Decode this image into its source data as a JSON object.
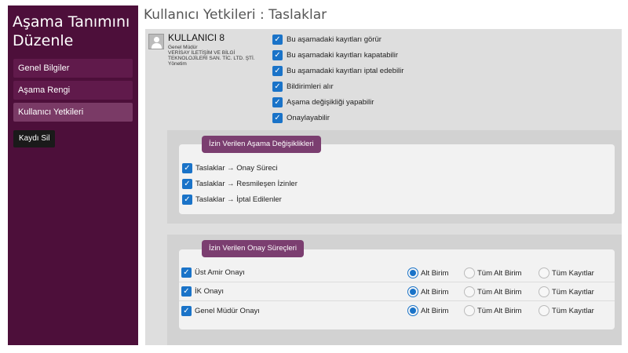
{
  "sidebar": {
    "title_line1": "Aşama Tanımını",
    "title_line2": "Düzenle",
    "items": [
      {
        "label": "Genel Bilgiler"
      },
      {
        "label": "Aşama Rengi"
      },
      {
        "label": "Kullanıcı Yetkileri"
      }
    ],
    "delete_label": "Kaydı Sil"
  },
  "main": {
    "title": "Kullanıcı Yetkileri : Taslaklar"
  },
  "user": {
    "name": "KULLANICI 8",
    "role": "Genel Müdür",
    "company_line1": "VERİSAY İLETİŞİM VE BİLGİ",
    "company_line2": "TEKNOLOJİLERİ SAN. TİC. LTD. ŞTİ.",
    "department": "Yönetim",
    "avatar_icon": "user-avatar-icon"
  },
  "permissions": [
    {
      "label": "Bu aşamadaki kayıtları görür",
      "checked": true
    },
    {
      "label": "Bu aşamadaki kayıtları kapatabilir",
      "checked": true
    },
    {
      "label": "Bu aşamadaki kayıtları iptal edebilir",
      "checked": true
    },
    {
      "label": "Bildirimleri alır",
      "checked": true
    },
    {
      "label": "Aşama değişikliği yapabilir",
      "checked": true
    },
    {
      "label": "Onaylayabilir",
      "checked": true
    }
  ],
  "transitions": {
    "title": "İzin Verilen Aşama Değişiklikleri",
    "items": [
      {
        "label": "Taslaklar → Onay Süreci",
        "checked": true
      },
      {
        "label": "Taslaklar → Resmileşen İzinler",
        "checked": true
      },
      {
        "label": "Taslaklar → İptal Edilenler",
        "checked": true
      }
    ]
  },
  "approvals": {
    "title": "İzin Verilen Onay Süreçleri",
    "options": [
      "Alt Birim",
      "Tüm Alt Birim",
      "Tüm Kayıtlar"
    ],
    "items": [
      {
        "label": "Üst Amir Onayı",
        "checked": true,
        "selected": "Alt Birim"
      },
      {
        "label": "İK Onayı",
        "checked": true,
        "selected": "Alt Birim"
      },
      {
        "label": "Genel Müdür Onayı",
        "checked": true,
        "selected": "Alt Birim"
      }
    ]
  },
  "colors": {
    "sidebar_bg": "#4d0f3a",
    "accent_tag": "#7b3e70",
    "checkbox": "#1a73c8"
  }
}
